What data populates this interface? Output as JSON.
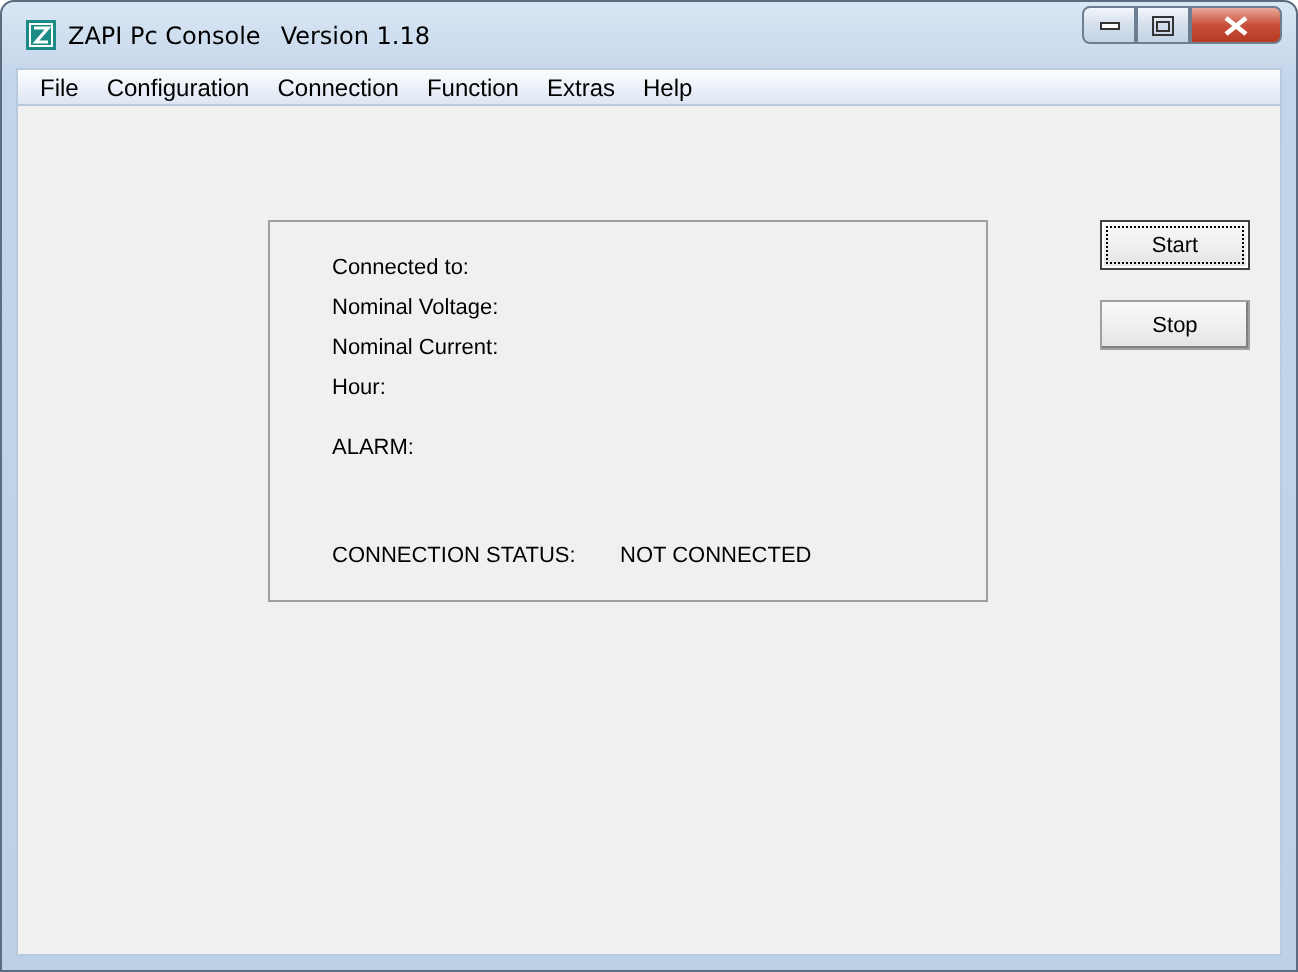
{
  "window": {
    "title": "ZAPI Pc Console",
    "version": "Version 1.18"
  },
  "menu": [
    "File",
    "Configuration",
    "Connection",
    "Function",
    "Extras",
    "Help"
  ],
  "info_fields": [
    "Connected to:",
    "Nominal Voltage:",
    "Nominal Current:",
    "Hour:"
  ],
  "alarm_label": "ALARM:",
  "connection_status": {
    "label": "CONNECTION STATUS:",
    "value": "NOT CONNECTED"
  },
  "buttons": [
    {
      "label": "Start",
      "focused": true
    },
    {
      "label": "Stop",
      "focused": false
    }
  ]
}
